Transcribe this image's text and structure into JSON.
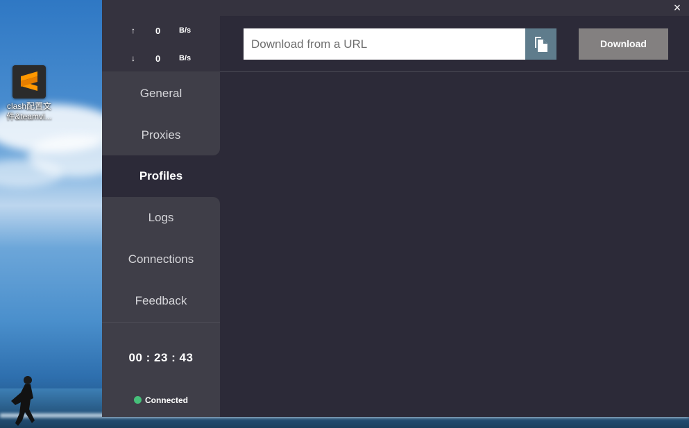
{
  "desktop": {
    "icon_label": "clash配置文件&teamvi..."
  },
  "window": {
    "close_icon": "×"
  },
  "traffic": {
    "upload_arrow": "↑",
    "upload_value": "0",
    "upload_unit": "B/s",
    "download_arrow": "↓",
    "download_value": "0",
    "download_unit": "B/s"
  },
  "nav": {
    "items": [
      {
        "label": "General"
      },
      {
        "label": "Proxies"
      },
      {
        "label": "Profiles",
        "active": true
      },
      {
        "label": "Logs"
      },
      {
        "label": "Connections"
      },
      {
        "label": "Feedback"
      }
    ]
  },
  "footer": {
    "timer": "00 : 23 : 43",
    "status": "Connected",
    "status_color": "#46c07a"
  },
  "profiles": {
    "url_placeholder": "Download from a URL",
    "url_value": "",
    "download_label": "Download"
  },
  "colors": {
    "window_bg": "#2c2a38",
    "sidebar_panel": "#3f3e48",
    "paste_button": "#5f7c8c",
    "download_button": "#838080"
  }
}
